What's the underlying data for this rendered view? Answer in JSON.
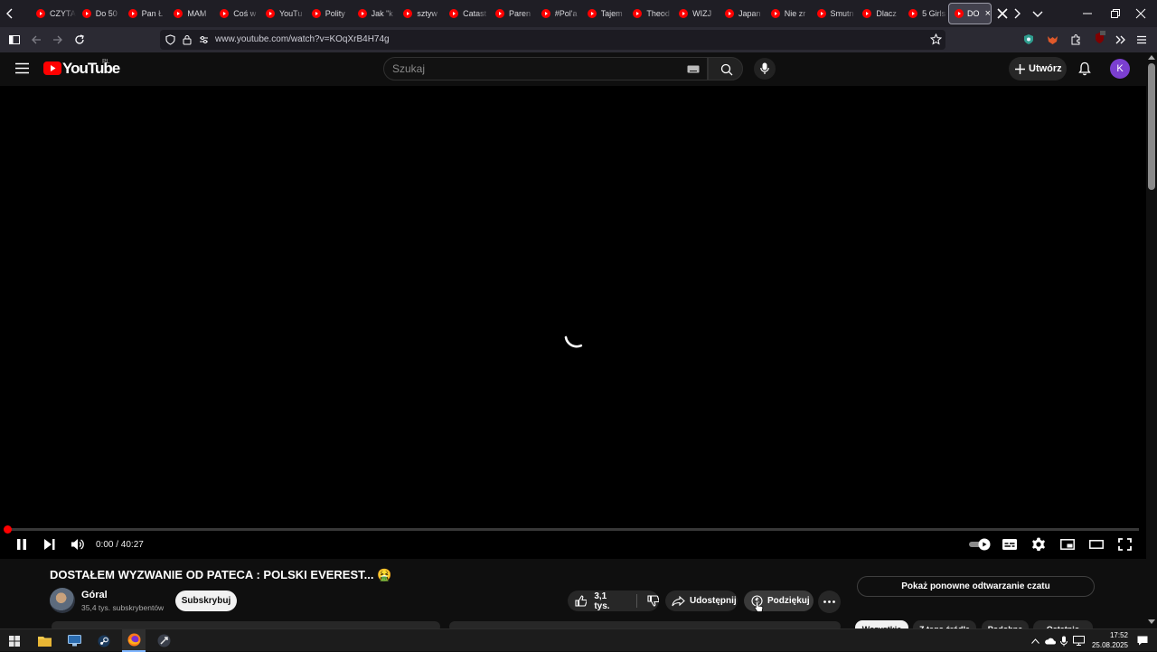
{
  "colors": {
    "accent": "#ff0000",
    "avatar": "#7b3fd0"
  },
  "browser": {
    "tabs": [
      {
        "label": "CZYTA"
      },
      {
        "label": "Do 50"
      },
      {
        "label": "Pan Ł"
      },
      {
        "label": "MAM"
      },
      {
        "label": "Coś w"
      },
      {
        "label": "YouTu"
      },
      {
        "label": "Polity"
      },
      {
        "label": "Jak \"k"
      },
      {
        "label": "sztyw"
      },
      {
        "label": "Catast"
      },
      {
        "label": "Paren"
      },
      {
        "label": "#Pol'a"
      },
      {
        "label": "Tajem"
      },
      {
        "label": "Theod"
      },
      {
        "label": "WIZJ"
      },
      {
        "label": "Japan"
      },
      {
        "label": "Nie zr"
      },
      {
        "label": "Smutn"
      },
      {
        "label": "Dlacz"
      },
      {
        "label": "5 Girls"
      }
    ],
    "active_tab": {
      "label": "DO"
    },
    "url": "www.youtube.com/watch?v=KOqXrB4H74g"
  },
  "youtube": {
    "logo": "YouTube",
    "region": "PL",
    "search_placeholder": "Szukaj",
    "create_label": "Utwórz",
    "avatar_letter": "K"
  },
  "player": {
    "time": "0:00 / 40:27",
    "progress": 0
  },
  "video": {
    "title": "DOSTAŁEM WYZWANIE OD PATECA : POLSKI EVEREST... 🤮",
    "channel": "Góral",
    "subscribers": "35,4 tys. subskrybentów",
    "subscribe_label": "Subskrybuj",
    "likes": "3,1 tys.",
    "share_label": "Udostępnij",
    "thanks_label": "Podziękuj"
  },
  "chat": {
    "replay_label": "Pokaż ponowne odtwarzanie czatu"
  },
  "chips": [
    {
      "label": "Wszystkie"
    },
    {
      "label": "Z tego źródła"
    },
    {
      "label": "Podobne"
    },
    {
      "label": "Ostatnio"
    }
  ],
  "taskbar": {
    "time": "17:52",
    "date": "25.08.2025"
  }
}
